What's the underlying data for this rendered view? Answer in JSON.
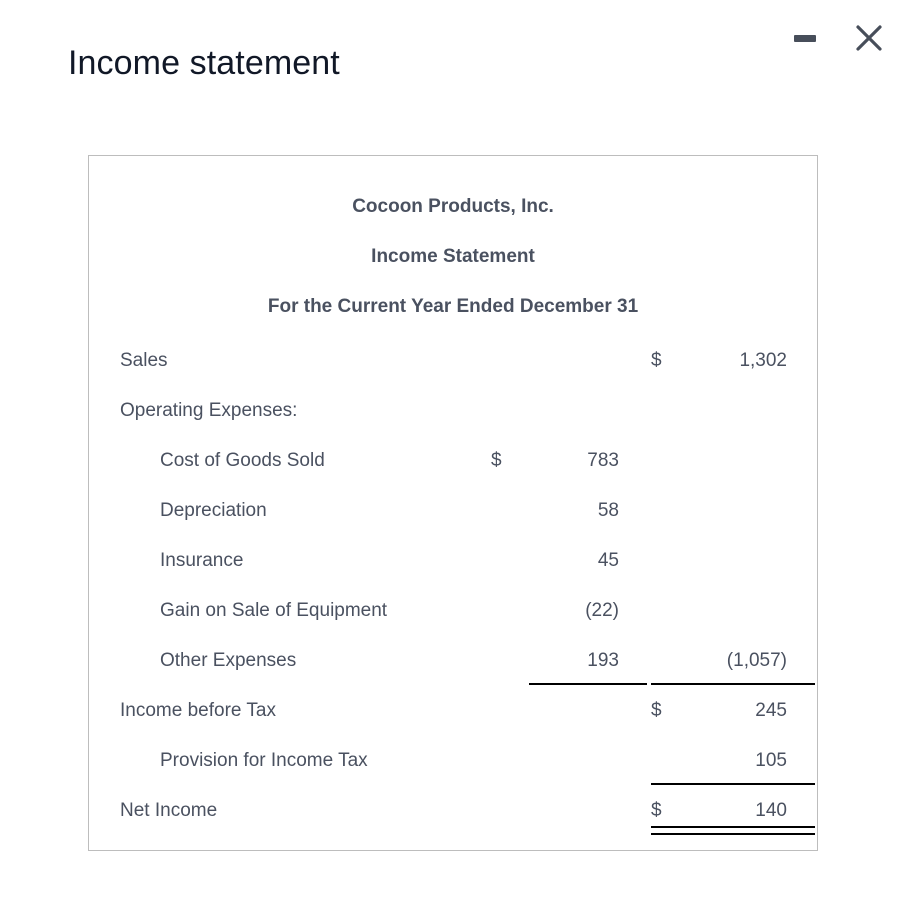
{
  "window": {
    "title": "Income statement",
    "minimize_label": "Minimize",
    "close_label": "Close"
  },
  "statement": {
    "headers": [
      "Cocoon Products, Inc.",
      "Income Statement",
      "For the Current Year Ended December 31"
    ],
    "rows": [
      {
        "label": "Sales",
        "indent": false,
        "inner_symbol": "",
        "inner_amount": "",
        "outer_symbol": "$",
        "outer_amount": "1,302"
      },
      {
        "label": "Operating Expenses:",
        "indent": false,
        "inner_symbol": "",
        "inner_amount": "",
        "outer_symbol": "",
        "outer_amount": ""
      },
      {
        "label": "Cost of Goods Sold",
        "indent": true,
        "inner_symbol": "$",
        "inner_amount": "783",
        "outer_symbol": "",
        "outer_amount": ""
      },
      {
        "label": "Depreciation",
        "indent": true,
        "inner_symbol": "",
        "inner_amount": "58",
        "outer_symbol": "",
        "outer_amount": ""
      },
      {
        "label": "Insurance",
        "indent": true,
        "inner_symbol": "",
        "inner_amount": "45",
        "outer_symbol": "",
        "outer_amount": ""
      },
      {
        "label": "Gain on Sale of Equipment",
        "indent": true,
        "inner_symbol": "",
        "inner_amount": "(22)",
        "outer_symbol": "",
        "outer_amount": ""
      },
      {
        "label": "Other Expenses",
        "indent": true,
        "inner_symbol": "",
        "inner_amount": "193",
        "outer_symbol": "",
        "outer_amount": "(1,057)"
      },
      {
        "label": "Income before Tax",
        "indent": false,
        "inner_symbol": "",
        "inner_amount": "",
        "outer_symbol": "$",
        "outer_amount": "245"
      },
      {
        "label": "Provision for Income Tax",
        "indent": true,
        "inner_symbol": "",
        "inner_amount": "",
        "outer_symbol": "",
        "outer_amount": "105"
      },
      {
        "label": "Net Income",
        "indent": false,
        "inner_symbol": "",
        "inner_amount": "",
        "outer_symbol": "$",
        "outer_amount": "140"
      }
    ]
  },
  "colors": {
    "text": "#4a5160",
    "title": "#111827",
    "panel_border": "#bdbdbd",
    "rule": "#000000",
    "icon": "#474e5a"
  }
}
